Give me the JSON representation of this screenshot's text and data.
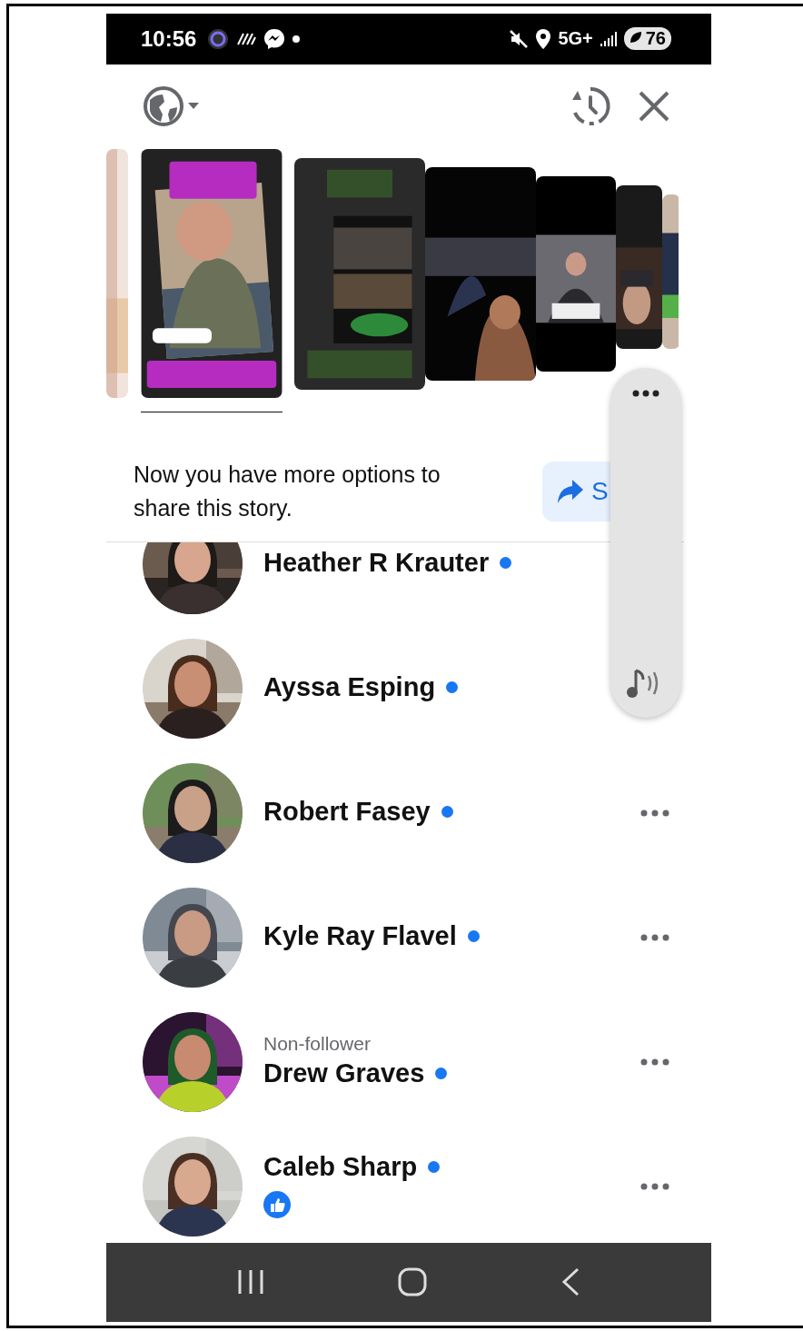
{
  "status_bar": {
    "time": "10:56",
    "network": "5G+",
    "battery": "76"
  },
  "stories": [
    {
      "selected": false
    },
    {
      "selected": true
    },
    {
      "selected": false
    },
    {
      "selected": false
    },
    {
      "selected": false
    },
    {
      "selected": false
    },
    {
      "selected": false
    }
  ],
  "share_prompt": {
    "text": "Now you have more options to share this story.",
    "button_label": "S"
  },
  "viewers": [
    {
      "name": "Heather R Krauter",
      "new_indicator": true,
      "more_menu": false
    },
    {
      "name": "Ayssa Esping",
      "new_indicator": true,
      "more_menu": false
    },
    {
      "name": "Robert Fasey",
      "new_indicator": true,
      "more_menu": true
    },
    {
      "name": "Kyle Ray Flavel",
      "new_indicator": true,
      "more_menu": true
    },
    {
      "name": "Drew Graves",
      "subtitle": "Non-follower",
      "new_indicator": true,
      "more_menu": true
    },
    {
      "name": "Caleb Sharp",
      "liked": true,
      "new_indicator": true,
      "more_menu": true
    }
  ]
}
